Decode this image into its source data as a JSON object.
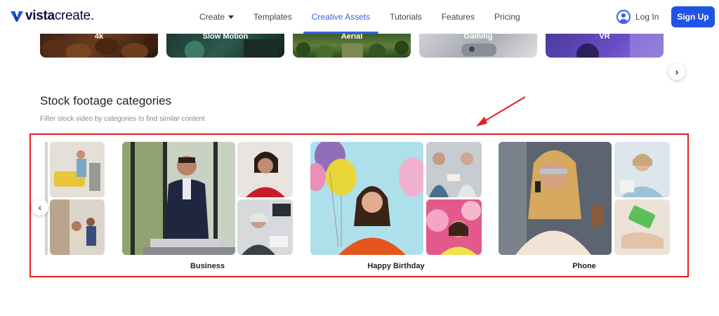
{
  "header": {
    "logo_bold": "vista",
    "logo_thin": "create",
    "logo_dot": ".",
    "nav": [
      "Create",
      "Templates",
      "Creative Assets",
      "Tutorials",
      "Features",
      "Pricing"
    ],
    "active_nav": "Creative Assets",
    "login_label": "Log In",
    "signup_label": "Sign Up"
  },
  "top_categories": [
    "4k",
    "Slow Motion",
    "Aerial",
    "Gaming",
    "VR"
  ],
  "section": {
    "title": "Stock footage categories",
    "subtitle": "Filter stock video by categories to find similar content"
  },
  "categories": [
    {
      "label": ""
    },
    {
      "label": "Business"
    },
    {
      "label": "Happy Birthday"
    },
    {
      "label": "Phone"
    }
  ],
  "colors": {
    "accent": "#1e53e5",
    "nav_active": "#3a61e0",
    "annotation": "#e02020"
  }
}
